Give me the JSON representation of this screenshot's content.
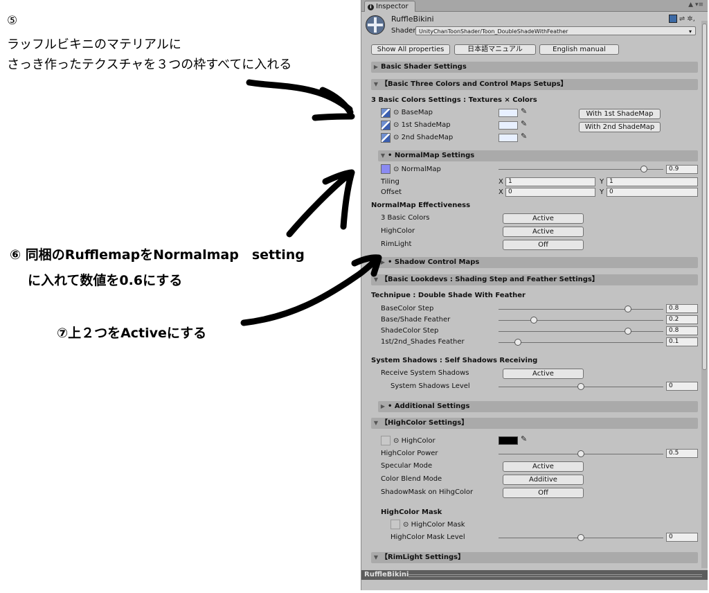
{
  "annotations": {
    "step5_number": "⑤",
    "step5_line1": "ラッフルビキニのマテリアルに",
    "step5_line2": "さっき作ったテクスチャを３つの枠すべてに入れる",
    "step6_line1": "⑥ 同梱のRufflemapをNormalmap　setting",
    "step6_line2": "に入れて数値を0.6にする",
    "step7": "⑦上２つをActiveにする"
  },
  "inspector": {
    "tab_label": "Inspector",
    "tab_tools": "▲ ▾≡",
    "object_name": "RuffleBikini",
    "shader_label": "Shader",
    "shader_value": "UnityChanToonShader/Toon_DoubleShadeWithFeather",
    "header_tools": "⇌ ✲,",
    "buttons": {
      "show_all": "Show All properties",
      "jp_manual": "日本語マニュアル",
      "en_manual": "English manual"
    },
    "sections": {
      "basic_shader": "Basic Shader Settings",
      "three_colors": "【Basic Three Colors and Control Maps Setups】",
      "normalmap": "• NormalMap Settings",
      "shadow_control": "• Shadow Control Maps",
      "lookdevs": "【Basic Lookdevs : Shading Step and Feather Settings】",
      "additional": "• Additional Settings",
      "highcolor": "【HighColor Settings】",
      "rimlight": "【RimLight Settings】"
    },
    "three_colors": {
      "heading": "3 Basic Colors Settings : Textures × Colors",
      "basemap": "BaseMap",
      "shade1": "1st ShadeMap",
      "shade2": "2nd ShadeMap",
      "btn_with1": "With 1st ShadeMap",
      "btn_with2": "With 2nd ShadeMap"
    },
    "normalmap": {
      "label": "NormalMap",
      "value": "0.9",
      "level": 0.9,
      "tiling_label": "Tiling",
      "offset_label": "Offset",
      "x_label": "X",
      "y_label": "Y",
      "tiling_x": "1",
      "tiling_y": "1",
      "offset_x": "0",
      "offset_y": "0",
      "effectiveness_heading": "NormalMap Effectiveness",
      "basic_colors_label": "3 Basic Colors",
      "basic_colors_value": "Active",
      "highcolor_label": "HighColor",
      "highcolor_value": "Active",
      "rimlight_label": "RimLight",
      "rimlight_value": "Off"
    },
    "lookdevs": {
      "heading": "Technipue : Double Shade With Feather",
      "rows": [
        {
          "label": "BaseColor Step",
          "value": "0.8",
          "level": 0.8
        },
        {
          "label": "Base/Shade Feather",
          "value": "0.2",
          "level": 0.2
        },
        {
          "label": "ShadeColor Step",
          "value": "0.8",
          "level": 0.8
        },
        {
          "label": "1st/2nd_Shades Feather",
          "value": "0.1",
          "level": 0.1
        }
      ],
      "shadows_heading": "System Shadows : Self Shadows Receiving",
      "receive_label": "Receive System Shadows",
      "receive_value": "Active",
      "level_label": "System Shadows Level",
      "level_value": "0",
      "level": 0.5
    },
    "highcolor": {
      "label": "HighColor",
      "color": "#000000",
      "power_label": "HighColor Power",
      "power_value": "0.5",
      "power_level": 0.5,
      "specular_label": "Specular Mode",
      "specular_value": "Active",
      "blend_label": "Color Blend Mode",
      "blend_value": "Additive",
      "shadowmask_label": "ShadowMask on HihgColor",
      "shadowmask_value": "Off",
      "mask_heading": "HighColor Mask",
      "mask_label": "HighColor Mask",
      "mask_level_label": "HighColor Mask Level",
      "mask_level_value": "0",
      "mask_level": 0.5
    },
    "footer": "RuffleBikini"
  }
}
